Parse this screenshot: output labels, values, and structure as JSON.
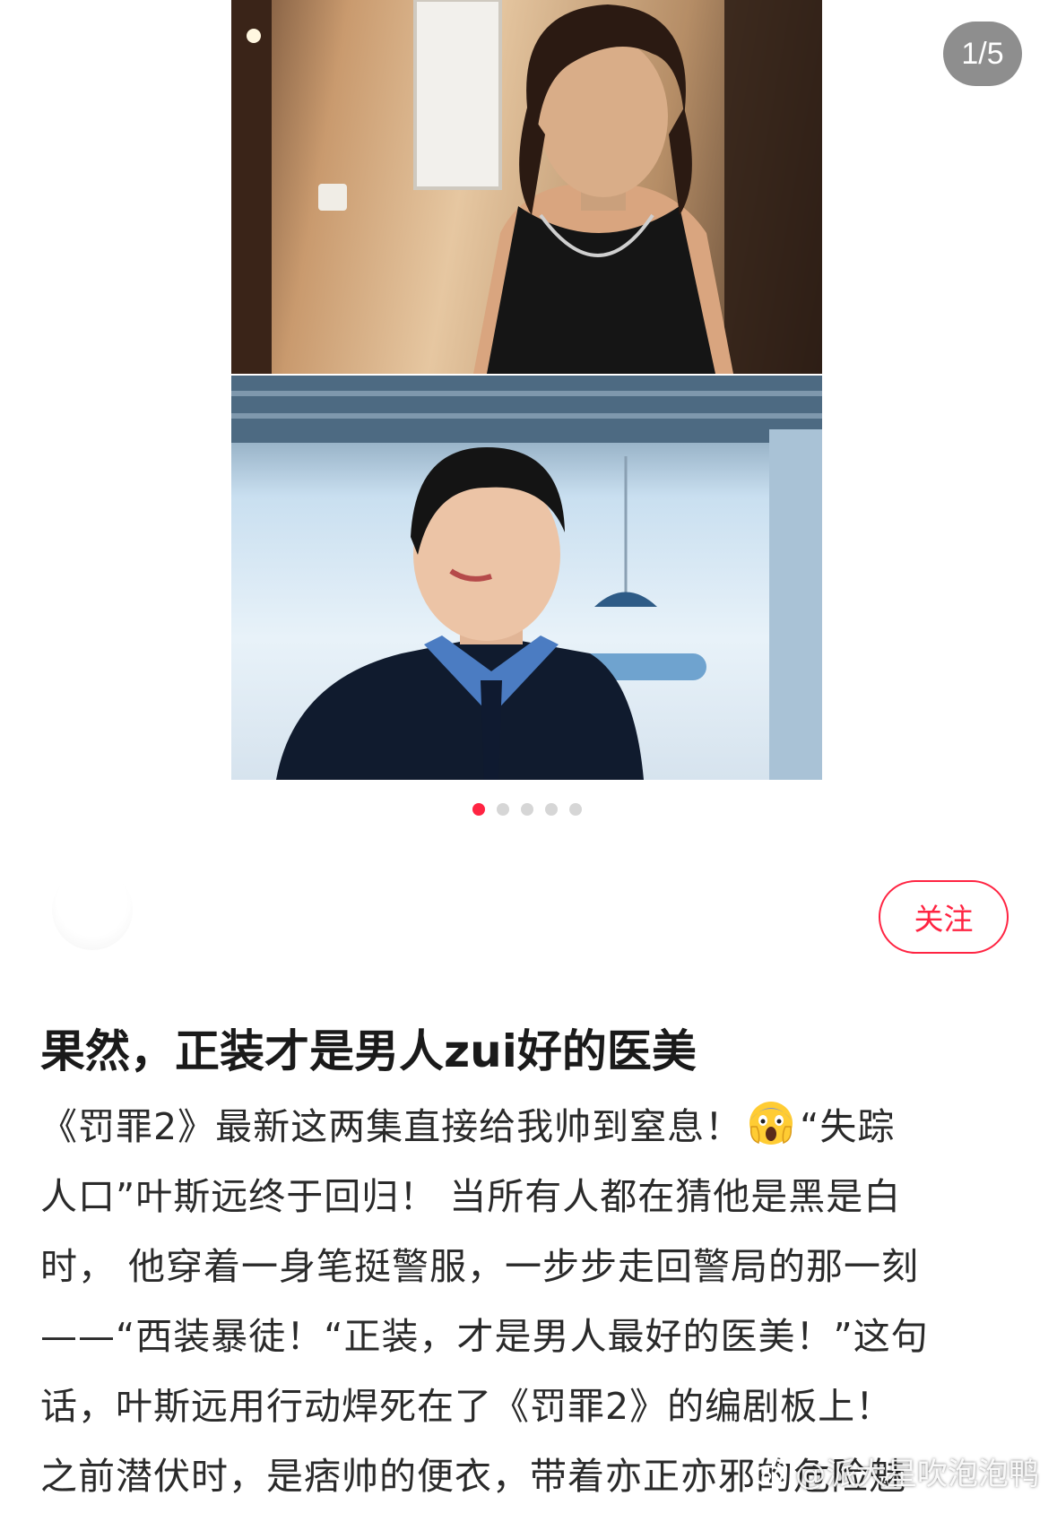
{
  "gallery": {
    "counter": "1/5",
    "total_images": 5,
    "current_index": 1
  },
  "author": {
    "follow_label": "关注"
  },
  "post": {
    "title": "果然，正装才是男人zui好的医美",
    "body_lines": [
      "《罚罪2》最新这两集直接给我帅到窒息！",
      "“失踪",
      "人口”叶斯远终于回归！ 当所有人都在猜他是黑是白",
      "时， 他穿着一身笔挺警服，一步步走回警局的那一刻",
      "——“西装暴徒！“正装，才是男人最好的医美！”这句",
      "话，叶斯远用行动焊死在了《罚罪2》的编剧板上！",
      "之前潜伏时，是痞帅的便衣，带着亦正亦邪的危险魅"
    ]
  },
  "watermark": {
    "text": "@派大星吹泡泡鸭"
  },
  "colors": {
    "accent": "#ff2442",
    "dot_inactive": "#d6d6d6",
    "counter_bg": "#6e6e6e"
  }
}
